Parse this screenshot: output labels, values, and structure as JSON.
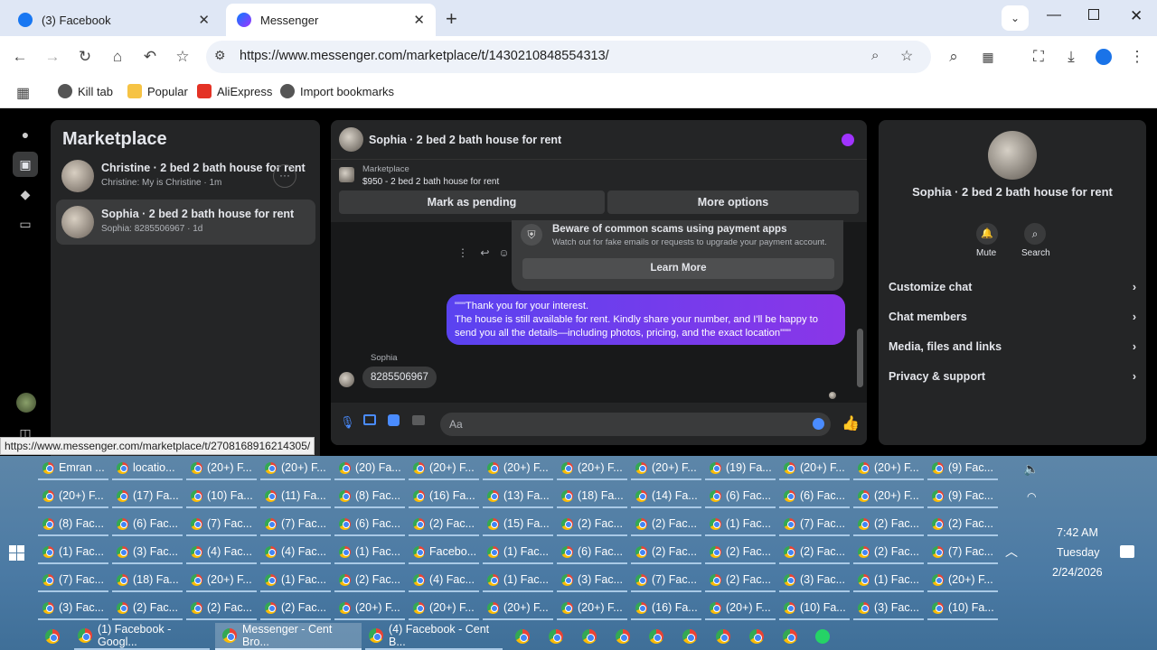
{
  "browser": {
    "tabs": [
      {
        "label": "(3) Facebook",
        "active": false
      },
      {
        "label": "Messenger",
        "active": true
      }
    ],
    "new_tab": "+",
    "url": "https://www.messenger.com/marketplace/t/1430210848554313/",
    "status_url": "https://www.messenger.com/marketplace/t/2708168916214305/",
    "bookmarks": [
      "Kill tab",
      "Popular",
      "AliExpress",
      "Import bookmarks"
    ]
  },
  "sidebar": {
    "title": "Marketplace",
    "conversations": [
      {
        "name": "Christine · 2 bed 2 bath house for rent",
        "preview": "Christine: My is Christine · 1m"
      },
      {
        "name": "Sophia · 2 bed 2 bath house for rent",
        "preview": "Sophia: 8285506967 · 1d"
      }
    ]
  },
  "chat": {
    "title": "Sophia · 2 bed 2 bath house for rent",
    "marketplace_label": "Marketplace",
    "listing": "$950 - 2 bed 2 bath house for rent",
    "mark_pending": "Mark as pending",
    "more_options": "More options",
    "scam_title": "Beware of common scams using payment apps",
    "scam_desc": "Watch out for fake emails or requests to upgrade your payment account.",
    "learn_more": "Learn More",
    "outgoing_message": "\"\"\"Thank you for your interest.\nThe house is still available for rent. Kindly share your number, and I'll be happy to send you all the details—including photos, pricing, and the exact location\"\"\"",
    "sender": "Sophia",
    "incoming_message": "8285506967",
    "composer_placeholder": "Aa"
  },
  "info": {
    "title": "Sophia · 2 bed 2 bath house for rent",
    "mute": "Mute",
    "search": "Search",
    "rows": [
      "Customize chat",
      "Chat members",
      "Media, files and links",
      "Privacy & support"
    ]
  },
  "taskbar": {
    "grid": [
      [
        "Emran ...",
        "locatio...",
        "(20+) F...",
        "(20+) F...",
        "(20) Fa...",
        "(20+) F...",
        "(20+) F...",
        "(20+) F...",
        "(20+) F...",
        "(19) Fa...",
        "(20+) F...",
        "(20+) F...",
        "(9) Fac..."
      ],
      [
        "(20+) F...",
        "(17) Fa...",
        "(10) Fa...",
        "(11) Fa...",
        "(8) Fac...",
        "(16) Fa...",
        "(13) Fa...",
        "(18) Fa...",
        "(14) Fa...",
        "(6) Fac...",
        "(6) Fac...",
        "(20+) F...",
        "(9) Fac..."
      ],
      [
        "(8) Fac...",
        "(6) Fac...",
        "(7) Fac...",
        "(7) Fac...",
        "(6) Fac...",
        "(2) Fac...",
        "(15) Fa...",
        "(2) Fac...",
        "(2) Fac...",
        "(1) Fac...",
        "(7) Fac...",
        "(2) Fac...",
        "(2) Fac..."
      ],
      [
        "(1) Fac...",
        "(3) Fac...",
        "(4) Fac...",
        "(4) Fac...",
        "(1) Fac...",
        "Facebo...",
        "(1) Fac...",
        "(6) Fac...",
        "(2) Fac...",
        "(2) Fac...",
        "(2) Fac...",
        "(2) Fac...",
        "(7) Fac..."
      ],
      [
        "(7) Fac...",
        "(18) Fa...",
        "(20+) F...",
        "(1) Fac...",
        "(2) Fac...",
        "(4) Fac...",
        "(1) Fac...",
        "(3) Fac...",
        "(7) Fac...",
        "(2) Fac...",
        "(3) Fac...",
        "(1) Fac...",
        "(20+) F..."
      ],
      [
        "(3) Fac...",
        "(2) Fac...",
        "(2) Fac...",
        "(2) Fac...",
        "(20+) F...",
        "(20+) F...",
        "(20+) F...",
        "(20+) F...",
        "(16) Fa...",
        "(20+) F...",
        "(10) Fa...",
        "(3) Fac...",
        "(10) Fa..."
      ]
    ],
    "bottom": [
      "(1) Facebook - Googl...",
      "Messenger - Cent Bro...",
      "(4) Facebook - Cent B..."
    ],
    "time": "7:42 AM",
    "day": "Tuesday",
    "date": "2/24/2026"
  },
  "colors": {
    "accent": "#0866ff",
    "bubble": "#7a3cf0",
    "taskbar": "#4b7aa4"
  }
}
